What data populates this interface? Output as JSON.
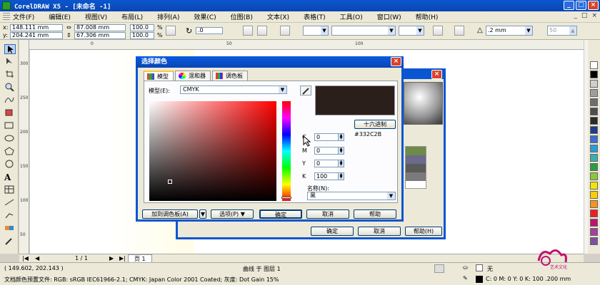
{
  "window": {
    "title": "CorelDRAW X5 - [未命名 -1]",
    "min": "_",
    "max": "□",
    "close": "×"
  },
  "menu": [
    "文件(F)",
    "编辑(E)",
    "视图(V)",
    "布局(L)",
    "排列(A)",
    "效果(C)",
    "位图(B)",
    "文本(X)",
    "表格(T)",
    "工具(O)",
    "窗口(W)",
    "帮助(H)"
  ],
  "menu_right": [
    "_",
    "□",
    "×"
  ],
  "props": {
    "x_label": "x:",
    "x": "148.111 mm",
    "y_label": "y:",
    "y": "204.241 mm",
    "w": "87.008 mm",
    "h": "67.306 mm",
    "sx": "100.0",
    "sy": "100.0",
    "pct": "%",
    "rot": ".0",
    "outline": ".2 mm",
    "corner": "50"
  },
  "ruler": {
    "top": [
      "0",
      "50",
      "100"
    ],
    "left": [
      "300",
      "250",
      "200",
      "150",
      "100",
      "50"
    ]
  },
  "palette_colors": [
    "#ffffff",
    "#000000",
    "#cfcfcf",
    "#9e9e9e",
    "#6e6e6e",
    "#4d4d4d",
    "#2a2a2a",
    "#1f3c8c",
    "#3a6ed0",
    "#2e9ad6",
    "#37b0b0",
    "#2a9d40",
    "#8cc63e",
    "#f2e600",
    "#ffcc00",
    "#f7941d",
    "#ed1c24",
    "#c0126d",
    "#a63ea0",
    "#7d4fa0"
  ],
  "pagenav": {
    "page_count": "1 / 1",
    "page_tab": "页 1"
  },
  "status": {
    "coords": "( 149.602, 202.143 )",
    "layer": "曲线 于 图层 1",
    "color_profile": "文档颜色预置文件: RGB: sRGB IEC61966-2.1; CMYK: Japan Color 2001 Coated; 灰度: Dot Gain 15%",
    "fill_label": "无",
    "outline_info": "C: 0 M: 0 Y: 0 K: 100  .200 mm"
  },
  "back_dialog": {
    "close": "×",
    "buttons": [
      "确定",
      "取消",
      "帮助(H)"
    ]
  },
  "dialog": {
    "title": "选择颜色",
    "close": "×",
    "tabs": [
      "模型",
      "混和器",
      "调色板"
    ],
    "model_label": "模型(E):",
    "model_value": "CMYK",
    "hex_button": "十六进制",
    "hex_value": "#332C2B",
    "channels": [
      {
        "label": "C",
        "value": "0"
      },
      {
        "label": "M",
        "value": "0"
      },
      {
        "label": "Y",
        "value": "0"
      },
      {
        "label": "K",
        "value": "100"
      }
    ],
    "name_label": "名称(N):",
    "name_value": "黑",
    "buttons": {
      "add_palette": "加到调色板(A)",
      "options": "选项(P)",
      "ok": "确定",
      "cancel": "取消",
      "help": "帮助"
    },
    "swatch_color": "#2b1f1c"
  },
  "logo_text": "艺术文化"
}
